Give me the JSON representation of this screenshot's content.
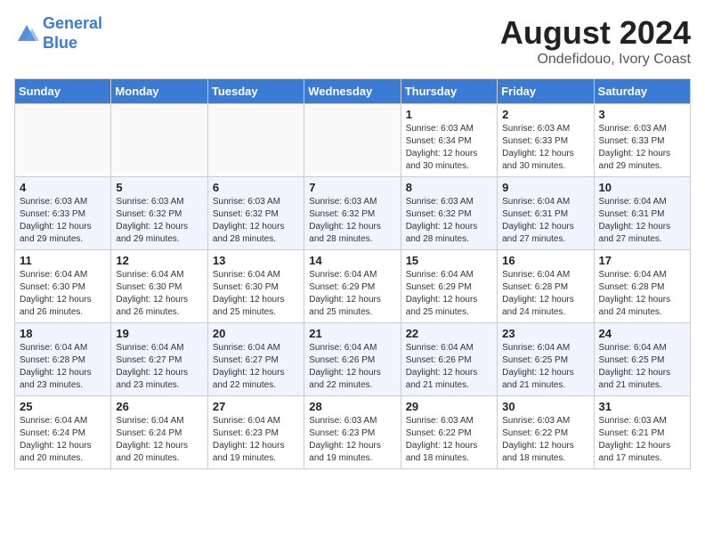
{
  "header": {
    "logo_line1": "General",
    "logo_line2": "Blue",
    "title": "August 2024",
    "subtitle": "Ondefidouo, Ivory Coast"
  },
  "weekdays": [
    "Sunday",
    "Monday",
    "Tuesday",
    "Wednesday",
    "Thursday",
    "Friday",
    "Saturday"
  ],
  "weeks": [
    [
      {
        "num": "",
        "info": ""
      },
      {
        "num": "",
        "info": ""
      },
      {
        "num": "",
        "info": ""
      },
      {
        "num": "",
        "info": ""
      },
      {
        "num": "1",
        "info": "Sunrise: 6:03 AM\nSunset: 6:34 PM\nDaylight: 12 hours\nand 30 minutes."
      },
      {
        "num": "2",
        "info": "Sunrise: 6:03 AM\nSunset: 6:33 PM\nDaylight: 12 hours\nand 30 minutes."
      },
      {
        "num": "3",
        "info": "Sunrise: 6:03 AM\nSunset: 6:33 PM\nDaylight: 12 hours\nand 29 minutes."
      }
    ],
    [
      {
        "num": "4",
        "info": "Sunrise: 6:03 AM\nSunset: 6:33 PM\nDaylight: 12 hours\nand 29 minutes."
      },
      {
        "num": "5",
        "info": "Sunrise: 6:03 AM\nSunset: 6:32 PM\nDaylight: 12 hours\nand 29 minutes."
      },
      {
        "num": "6",
        "info": "Sunrise: 6:03 AM\nSunset: 6:32 PM\nDaylight: 12 hours\nand 28 minutes."
      },
      {
        "num": "7",
        "info": "Sunrise: 6:03 AM\nSunset: 6:32 PM\nDaylight: 12 hours\nand 28 minutes."
      },
      {
        "num": "8",
        "info": "Sunrise: 6:03 AM\nSunset: 6:32 PM\nDaylight: 12 hours\nand 28 minutes."
      },
      {
        "num": "9",
        "info": "Sunrise: 6:04 AM\nSunset: 6:31 PM\nDaylight: 12 hours\nand 27 minutes."
      },
      {
        "num": "10",
        "info": "Sunrise: 6:04 AM\nSunset: 6:31 PM\nDaylight: 12 hours\nand 27 minutes."
      }
    ],
    [
      {
        "num": "11",
        "info": "Sunrise: 6:04 AM\nSunset: 6:30 PM\nDaylight: 12 hours\nand 26 minutes."
      },
      {
        "num": "12",
        "info": "Sunrise: 6:04 AM\nSunset: 6:30 PM\nDaylight: 12 hours\nand 26 minutes."
      },
      {
        "num": "13",
        "info": "Sunrise: 6:04 AM\nSunset: 6:30 PM\nDaylight: 12 hours\nand 25 minutes."
      },
      {
        "num": "14",
        "info": "Sunrise: 6:04 AM\nSunset: 6:29 PM\nDaylight: 12 hours\nand 25 minutes."
      },
      {
        "num": "15",
        "info": "Sunrise: 6:04 AM\nSunset: 6:29 PM\nDaylight: 12 hours\nand 25 minutes."
      },
      {
        "num": "16",
        "info": "Sunrise: 6:04 AM\nSunset: 6:28 PM\nDaylight: 12 hours\nand 24 minutes."
      },
      {
        "num": "17",
        "info": "Sunrise: 6:04 AM\nSunset: 6:28 PM\nDaylight: 12 hours\nand 24 minutes."
      }
    ],
    [
      {
        "num": "18",
        "info": "Sunrise: 6:04 AM\nSunset: 6:28 PM\nDaylight: 12 hours\nand 23 minutes."
      },
      {
        "num": "19",
        "info": "Sunrise: 6:04 AM\nSunset: 6:27 PM\nDaylight: 12 hours\nand 23 minutes."
      },
      {
        "num": "20",
        "info": "Sunrise: 6:04 AM\nSunset: 6:27 PM\nDaylight: 12 hours\nand 22 minutes."
      },
      {
        "num": "21",
        "info": "Sunrise: 6:04 AM\nSunset: 6:26 PM\nDaylight: 12 hours\nand 22 minutes."
      },
      {
        "num": "22",
        "info": "Sunrise: 6:04 AM\nSunset: 6:26 PM\nDaylight: 12 hours\nand 21 minutes."
      },
      {
        "num": "23",
        "info": "Sunrise: 6:04 AM\nSunset: 6:25 PM\nDaylight: 12 hours\nand 21 minutes."
      },
      {
        "num": "24",
        "info": "Sunrise: 6:04 AM\nSunset: 6:25 PM\nDaylight: 12 hours\nand 21 minutes."
      }
    ],
    [
      {
        "num": "25",
        "info": "Sunrise: 6:04 AM\nSunset: 6:24 PM\nDaylight: 12 hours\nand 20 minutes."
      },
      {
        "num": "26",
        "info": "Sunrise: 6:04 AM\nSunset: 6:24 PM\nDaylight: 12 hours\nand 20 minutes."
      },
      {
        "num": "27",
        "info": "Sunrise: 6:04 AM\nSunset: 6:23 PM\nDaylight: 12 hours\nand 19 minutes."
      },
      {
        "num": "28",
        "info": "Sunrise: 6:03 AM\nSunset: 6:23 PM\nDaylight: 12 hours\nand 19 minutes."
      },
      {
        "num": "29",
        "info": "Sunrise: 6:03 AM\nSunset: 6:22 PM\nDaylight: 12 hours\nand 18 minutes."
      },
      {
        "num": "30",
        "info": "Sunrise: 6:03 AM\nSunset: 6:22 PM\nDaylight: 12 hours\nand 18 minutes."
      },
      {
        "num": "31",
        "info": "Sunrise: 6:03 AM\nSunset: 6:21 PM\nDaylight: 12 hours\nand 17 minutes."
      }
    ]
  ]
}
